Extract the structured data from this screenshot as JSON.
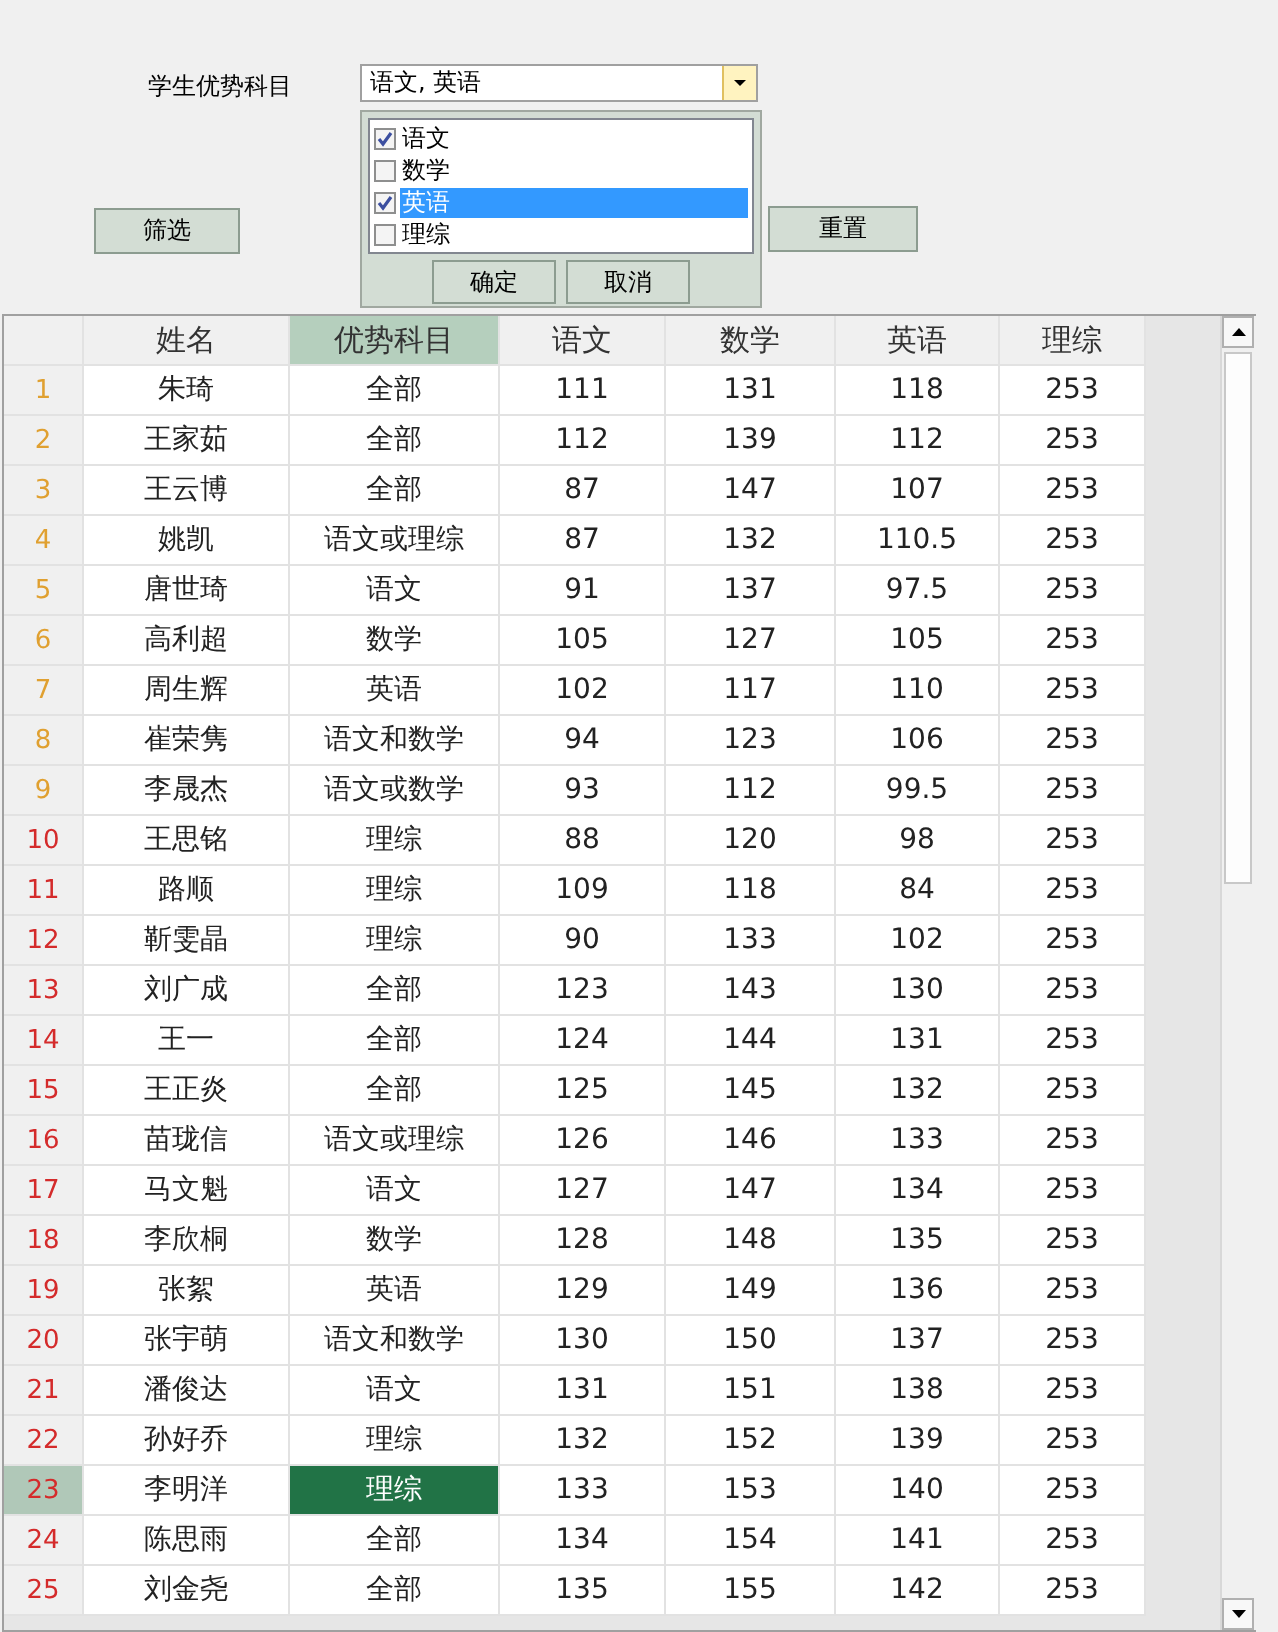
{
  "filter": {
    "label": "学生优势科目",
    "combo_value": "语文, 英语",
    "dropdown": {
      "options": [
        {
          "label": "语文",
          "checked": true,
          "selected": false
        },
        {
          "label": "数学",
          "checked": false,
          "selected": false
        },
        {
          "label": "英语",
          "checked": true,
          "selected": true
        },
        {
          "label": "理综",
          "checked": false,
          "selected": false
        }
      ],
      "buttons": [
        "确定",
        "取消"
      ]
    },
    "filter_button": "筛选",
    "reset_button": "重置"
  },
  "table": {
    "columns": [
      {
        "label": "姓名",
        "selected": false
      },
      {
        "label": "优势科目",
        "selected": true
      },
      {
        "label": "语文",
        "selected": false
      },
      {
        "label": "数学",
        "selected": false
      },
      {
        "label": "英语",
        "selected": false
      },
      {
        "label": "理综",
        "selected": false
      }
    ],
    "rows": [
      {
        "num": "1",
        "color": "#e0a030",
        "cells": [
          "朱琦",
          "全部",
          "111",
          "131",
          "118",
          "253"
        ],
        "selected": false
      },
      {
        "num": "2",
        "color": "#e0a030",
        "cells": [
          "王家茹",
          "全部",
          "112",
          "139",
          "112",
          "253"
        ],
        "selected": false
      },
      {
        "num": "3",
        "color": "#e0a030",
        "cells": [
          "王云博",
          "全部",
          "87",
          "147",
          "107",
          "253"
        ],
        "selected": false
      },
      {
        "num": "4",
        "color": "#e0a030",
        "cells": [
          "姚凯",
          "语文或理综",
          "87",
          "132",
          "110.5",
          "253"
        ],
        "selected": false
      },
      {
        "num": "5",
        "color": "#e0a030",
        "cells": [
          "唐世琦",
          "语文",
          "91",
          "137",
          "97.5",
          "253"
        ],
        "selected": false
      },
      {
        "num": "6",
        "color": "#e0a030",
        "cells": [
          "高利超",
          "数学",
          "105",
          "127",
          "105",
          "253"
        ],
        "selected": false
      },
      {
        "num": "7",
        "color": "#e0a030",
        "cells": [
          "周生辉",
          "英语",
          "102",
          "117",
          "110",
          "253"
        ],
        "selected": false
      },
      {
        "num": "8",
        "color": "#e0a030",
        "cells": [
          "崔荣隽",
          "语文和数学",
          "94",
          "123",
          "106",
          "253"
        ],
        "selected": false
      },
      {
        "num": "9",
        "color": "#e0a030",
        "cells": [
          "李晟杰",
          "语文或数学",
          "93",
          "112",
          "99.5",
          "253"
        ],
        "selected": false
      },
      {
        "num": "10",
        "color": "#d42b2b",
        "cells": [
          "王思铭",
          "理综",
          "88",
          "120",
          "98",
          "253"
        ],
        "selected": false
      },
      {
        "num": "11",
        "color": "#d42b2b",
        "cells": [
          "路顺",
          "理综",
          "109",
          "118",
          "84",
          "253"
        ],
        "selected": false
      },
      {
        "num": "12",
        "color": "#d42b2b",
        "cells": [
          "靳雯晶",
          "理综",
          "90",
          "133",
          "102",
          "253"
        ],
        "selected": false
      },
      {
        "num": "13",
        "color": "#d42b2b",
        "cells": [
          "刘广成",
          "全部",
          "123",
          "143",
          "130",
          "253"
        ],
        "selected": false
      },
      {
        "num": "14",
        "color": "#d42b2b",
        "cells": [
          "王一",
          "全部",
          "124",
          "144",
          "131",
          "253"
        ],
        "selected": false
      },
      {
        "num": "15",
        "color": "#d42b2b",
        "cells": [
          "王正炎",
          "全部",
          "125",
          "145",
          "132",
          "253"
        ],
        "selected": false
      },
      {
        "num": "16",
        "color": "#d42b2b",
        "cells": [
          "苗珑信",
          "语文或理综",
          "126",
          "146",
          "133",
          "253"
        ],
        "selected": false
      },
      {
        "num": "17",
        "color": "#d42b2b",
        "cells": [
          "马文魁",
          "语文",
          "127",
          "147",
          "134",
          "253"
        ],
        "selected": false
      },
      {
        "num": "18",
        "color": "#d42b2b",
        "cells": [
          "李欣桐",
          "数学",
          "128",
          "148",
          "135",
          "253"
        ],
        "selected": false
      },
      {
        "num": "19",
        "color": "#d42b2b",
        "cells": [
          "张絮",
          "英语",
          "129",
          "149",
          "136",
          "253"
        ],
        "selected": false
      },
      {
        "num": "20",
        "color": "#d42b2b",
        "cells": [
          "张宇萌",
          "语文和数学",
          "130",
          "150",
          "137",
          "253"
        ],
        "selected": false
      },
      {
        "num": "21",
        "color": "#d42b2b",
        "cells": [
          "潘俊达",
          "语文",
          "131",
          "151",
          "138",
          "253"
        ],
        "selected": false
      },
      {
        "num": "22",
        "color": "#d42b2b",
        "cells": [
          "孙好乔",
          "理综",
          "132",
          "152",
          "139",
          "253"
        ],
        "selected": false
      },
      {
        "num": "23",
        "color": "#d42b2b",
        "cells": [
          "李明洋",
          "理综",
          "133",
          "153",
          "140",
          "253"
        ],
        "selected": true
      },
      {
        "num": "24",
        "color": "#d42b2b",
        "cells": [
          "陈思雨",
          "全部",
          "134",
          "154",
          "141",
          "253"
        ],
        "selected": false
      },
      {
        "num": "25",
        "color": "#d42b2b",
        "cells": [
          "刘金尧",
          "全部",
          "135",
          "155",
          "142",
          "253"
        ],
        "selected": false
      }
    ]
  }
}
